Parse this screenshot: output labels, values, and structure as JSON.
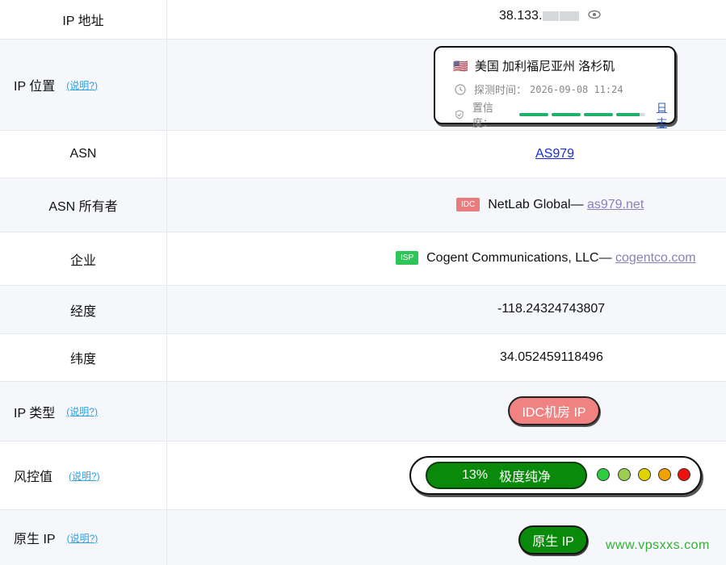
{
  "rows": {
    "ip": {
      "label": "IP 地址",
      "value": "38.133."
    },
    "location": {
      "label": "IP 位置",
      "help": "(说明?)",
      "flag": "🇺🇸",
      "place": "美国 加利福尼亚州 洛杉矶",
      "probe_label": "探测时间：",
      "probe_time": "2026-09-08 11:24",
      "confidence_label": "置信度：",
      "log_link": "日志"
    },
    "asn": {
      "label": "ASN",
      "value": "AS979"
    },
    "asn_owner": {
      "label": "ASN 所有者",
      "tag": "IDC",
      "name": "NetLab Global—",
      "domain": "as979.net"
    },
    "company": {
      "label": "企业",
      "tag": "ISP",
      "name": "Cogent Communications, LLC—",
      "domain": "cogentco.com"
    },
    "longitude": {
      "label": "经度",
      "value": "-118.24324743807"
    },
    "latitude": {
      "label": "纬度",
      "value": "34.052459118496"
    },
    "ip_type": {
      "label": "IP 类型",
      "help": "(说明?)",
      "value": "IDC机房 IP"
    },
    "risk": {
      "label": "风控值",
      "help": "(说明?)",
      "percent": "13%",
      "desc": "极度纯净",
      "dots": [
        "#2ecc40",
        "#9acd50",
        "#e0d400",
        "#f0a000",
        "#ee1111"
      ]
    },
    "native": {
      "label": "原生 IP",
      "help": "(说明?)",
      "value": "原生 IP"
    }
  },
  "watermark": "www.vpsxxs.com",
  "colors": {
    "confidence": "#1fb16b",
    "link": "#8a7fb8",
    "help": "#2aa0e0",
    "risk_green": "#0a8a0a"
  }
}
